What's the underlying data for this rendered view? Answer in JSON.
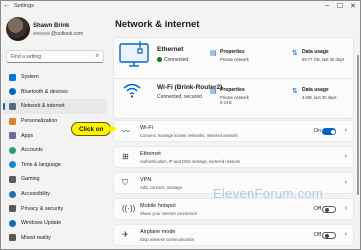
{
  "window": {
    "title": "Settings",
    "back_icon": "back-arrow-icon",
    "controls": [
      "minimize-icon",
      "maximize-icon",
      "close-icon"
    ]
  },
  "profile": {
    "name": "Shawn Brink",
    "email_visible": "@outlook.com"
  },
  "search": {
    "placeholder": "Find a setting"
  },
  "sidebar": {
    "items": [
      {
        "label": "System",
        "color": "#0078d4"
      },
      {
        "label": "Bluetooth & devices",
        "color": "#0067c0"
      },
      {
        "label": "Network & internet",
        "color": "#5a6b7d",
        "active": true
      },
      {
        "label": "Personalization",
        "color": "#d9822b"
      },
      {
        "label": "Apps",
        "color": "#6b6b9b"
      },
      {
        "label": "Accounts",
        "color": "#2e9e6a"
      },
      {
        "label": "Time & language",
        "color": "#1a8ad4"
      },
      {
        "label": "Gaming",
        "color": "#5c5c5c"
      },
      {
        "label": "Accessibility",
        "color": "#1f6fb2"
      },
      {
        "label": "Privacy & security",
        "color": "#5b5b5b"
      },
      {
        "label": "Windows Update",
        "color": "#0f6cbd"
      },
      {
        "label": "Mixed reality",
        "color": "#555555"
      }
    ]
  },
  "main": {
    "title": "Network & internet",
    "ethernet": {
      "name": "Ethernet",
      "status": "Connected",
      "properties": {
        "title": "Properties",
        "subtitle": "Private network"
      },
      "data_usage": {
        "title": "Data usage",
        "subtitle": "59.77 GB, last 30 days"
      }
    },
    "wifi": {
      "name": "Wi-Fi (Brink-Router2)",
      "status": "Connected, secured",
      "properties": {
        "title": "Properties",
        "subtitle": "Private network\n5 GHz"
      },
      "data_usage": {
        "title": "Data usage",
        "subtitle": "3 MB, last 30 days"
      }
    },
    "rows": [
      {
        "title": "Wi-Fi",
        "desc": "Connect, manage known networks, metered network",
        "state": "On",
        "toggle": true,
        "toggle_on": true,
        "icon": "wifi-icon"
      },
      {
        "title": "Ethernet",
        "desc": "Authentication, IP and DNS settings, metered network",
        "icon": "ethernet-icon"
      },
      {
        "title": "VPN",
        "desc": "Add, connect, manage",
        "icon": "vpn-shield-icon"
      },
      {
        "title": "Mobile hotspot",
        "desc": "Share your internet connection",
        "state": "Off",
        "toggle": true,
        "toggle_on": false,
        "icon": "hotspot-icon"
      },
      {
        "title": "Airplane mode",
        "desc": "Stop wireless communication",
        "state": "Off",
        "toggle": true,
        "toggle_on": false,
        "icon": "airplane-icon"
      }
    ]
  },
  "callout": {
    "text": "Click on",
    "color": "#fff200"
  },
  "watermark": "ElevenForum.com",
  "colors": {
    "accent": "#0067c0",
    "connected": "#0f7b0f"
  }
}
